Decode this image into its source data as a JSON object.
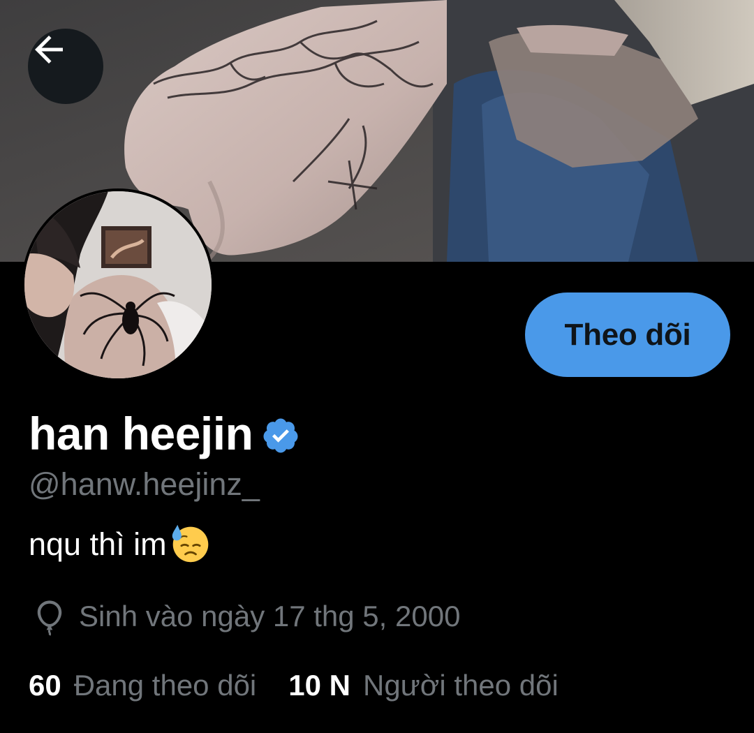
{
  "header": {
    "back_icon": "arrow-left-icon"
  },
  "profile": {
    "display_name": "han heejin",
    "verified_icon": "verified-badge-icon",
    "verified_color": "#4a99e9",
    "handle": "@hanw.heejinz_",
    "bio_text": "nqu thì im",
    "bio_emoji": "downcast-face-with-sweat-emoji",
    "birthday_icon": "balloon-icon",
    "birthday_text": "Sinh vào ngày 17 thg 5, 2000"
  },
  "actions": {
    "follow_label": "Theo dõi",
    "follow_color": "#4a99e9"
  },
  "stats": {
    "following_count": "60",
    "following_label": "Đang theo dõi",
    "followers_count": "10 N",
    "followers_label": "Người theo dõi"
  }
}
